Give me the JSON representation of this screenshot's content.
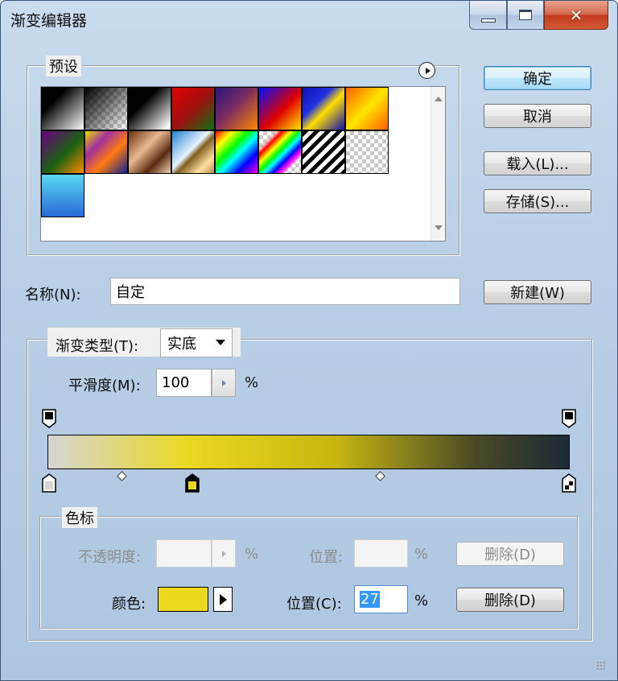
{
  "window": {
    "title": "渐变编辑器",
    "close_glyph": "✕"
  },
  "presets": {
    "label": "预设",
    "menu_icon": "circle-arrow-icon",
    "swatches": [
      {
        "name": "black-white"
      },
      {
        "name": "black-transparent"
      },
      {
        "name": "black-white-2"
      },
      {
        "name": "red-green"
      },
      {
        "name": "violet-orange"
      },
      {
        "name": "blue-red-yellow"
      },
      {
        "name": "blue-yellow-blue"
      },
      {
        "name": "orange-yellow-orange"
      },
      {
        "name": "violet-green-orange"
      },
      {
        "name": "yellow-violet-orange-blue"
      },
      {
        "name": "copper"
      },
      {
        "name": "chrome"
      },
      {
        "name": "spectrum"
      },
      {
        "name": "transparent-rainbow"
      },
      {
        "name": "transparent-stripes"
      },
      {
        "name": "transparent-checker"
      },
      {
        "name": "cyan-blue"
      }
    ]
  },
  "buttons": {
    "ok": "确定",
    "cancel": "取消",
    "load": "载入(L)...",
    "save": "存储(S)...",
    "new": "新建(W)"
  },
  "name_field": {
    "label": "名称(N):",
    "value": "自定"
  },
  "gradient_type": {
    "label": "渐变类型(T):",
    "value": "实底"
  },
  "smoothness": {
    "label": "平滑度(M):",
    "value": "100",
    "unit": "%"
  },
  "color_stops": {
    "label": "色标",
    "opacity_label": "不透明度:",
    "opacity_unit": "%",
    "opacity_location_label": "位置:",
    "opacity_location_unit": "%",
    "opacity_delete": "删除(D)",
    "color_label": "颜色:",
    "color_value": "#ebd81f",
    "location_label": "位置(C):",
    "location_value": "27",
    "location_unit": "%",
    "delete": "删除(D)"
  },
  "gradient": {
    "colors": [
      "#d5d5d5",
      "#ebd81f",
      "#4a4a26",
      "#1b2a36"
    ],
    "color_stop_locations": [
      0,
      27,
      100
    ],
    "selected_stop_location": 27
  }
}
